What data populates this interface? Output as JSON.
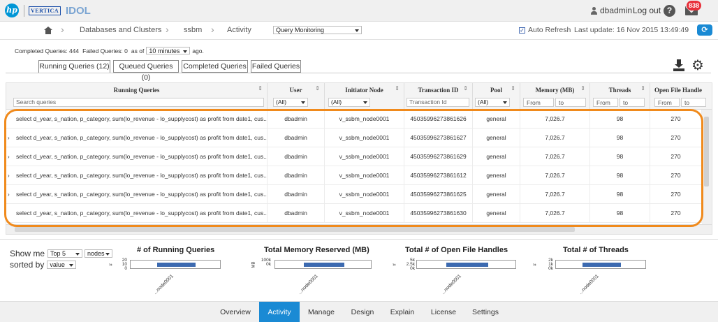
{
  "header": {
    "product_name": "IDOL",
    "vertica_logo": "VERTICA",
    "hp_logo": "hp",
    "username": "dbadmin",
    "logout_label": "Log out",
    "help_glyph": "?",
    "notification_count": "838"
  },
  "breadcrumb": {
    "items": [
      "Databases and Clusters",
      "ssbm",
      "Activity"
    ],
    "view_select": "Query Monitoring",
    "auto_refresh_label": "Auto Refresh",
    "auto_refresh_checked": true,
    "last_update": "Last update:  16 Nov 2015 13:49:49"
  },
  "stats": {
    "completed": "Completed Queries: 444",
    "failed": "Failed Queries: 0",
    "as_of": "as of",
    "interval": "10 minutes",
    "ago": "ago."
  },
  "tabs": [
    {
      "label": "Running Queries (12)",
      "active": true
    },
    {
      "label": "Queued Queries (0)",
      "active": false
    },
    {
      "label": "Completed Queries",
      "active": false
    },
    {
      "label": "Failed Queries",
      "active": false
    }
  ],
  "table": {
    "columns": [
      "Running Queries",
      "User",
      "Initiator Node",
      "Transaction ID",
      "Pool",
      "Memory (MB)",
      "Threads",
      "Open File Handle"
    ],
    "filters": {
      "search_placeholder": "Search queries",
      "user": "(All)",
      "node": "(All)",
      "txn_placeholder": "Transaction Id",
      "pool": "(All)",
      "from": "From",
      "to": "to"
    },
    "rows": [
      {
        "query": "select d_year, s_nation, p_category, sum(lo_revenue - lo_supplycost) as profit from date1, cus...",
        "user": "dbadmin",
        "node": "v_ssbm_node0001",
        "txn": "45035996273861626",
        "pool": "general",
        "memory": "7,026.7",
        "threads": "98",
        "handles": "270",
        "expander": ""
      },
      {
        "query": "select d_year, s_nation, p_category, sum(lo_revenue - lo_supplycost) as profit from date1, cus...",
        "user": "dbadmin",
        "node": "v_ssbm_node0001",
        "txn": "45035996273861627",
        "pool": "general",
        "memory": "7,026.7",
        "threads": "98",
        "handles": "270",
        "expander": "›"
      },
      {
        "query": "select d_year, s_nation, p_category, sum(lo_revenue - lo_supplycost) as profit from date1, cus...",
        "user": "dbadmin",
        "node": "v_ssbm_node0001",
        "txn": "45035996273861629",
        "pool": "general",
        "memory": "7,026.7",
        "threads": "98",
        "handles": "270",
        "expander": "›"
      },
      {
        "query": "select d_year, s_nation, p_category, sum(lo_revenue - lo_supplycost) as profit from date1, cus...",
        "user": "dbadmin",
        "node": "v_ssbm_node0001",
        "txn": "45035996273861612",
        "pool": "general",
        "memory": "7,026.7",
        "threads": "98",
        "handles": "270",
        "expander": "›"
      },
      {
        "query": "select d_year, s_nation, p_category, sum(lo_revenue - lo_supplycost) as profit from date1, cus...",
        "user": "dbadmin",
        "node": "v_ssbm_node0001",
        "txn": "45035996273861625",
        "pool": "general",
        "memory": "7,026.7",
        "threads": "98",
        "handles": "270",
        "expander": "›"
      },
      {
        "query": "select d_year, s_nation, p_category, sum(lo_revenue - lo_supplycost) as profit from date1, cus...",
        "user": "dbadmin",
        "node": "v_ssbm_node0001",
        "txn": "45035996273861630",
        "pool": "general",
        "memory": "7,026.7",
        "threads": "98",
        "handles": "270",
        "expander": ""
      }
    ]
  },
  "summary": {
    "show_me_label": "Show me",
    "top_select": "Top 5",
    "group_select": "nodes",
    "sorted_by_label": "sorted by",
    "sort_select": "value",
    "charts": [
      {
        "title": "# of Running Queries",
        "unit": "#",
        "ticks": [
          "20",
          "10",
          "0"
        ],
        "node_label": "...node0001",
        "bar_fill": 0.65
      },
      {
        "title": "Total Memory Reserved (MB)",
        "unit": "MB",
        "ticks": [
          "100k",
          "0k"
        ],
        "node_label": "...node0001",
        "bar_fill": 0.65
      },
      {
        "title": "Total # of Open File Handles",
        "unit": "#",
        "ticks": [
          "5k",
          "2.5k",
          "0k"
        ],
        "node_label": "...node0001",
        "bar_fill": 0.65
      },
      {
        "title": "Total # of Threads",
        "unit": "#",
        "ticks": [
          "2k",
          "1k",
          "0k"
        ],
        "node_label": "...node0001",
        "bar_fill": 0.65
      }
    ]
  },
  "bottom_nav": [
    {
      "label": "Overview",
      "active": false
    },
    {
      "label": "Activity",
      "active": true
    },
    {
      "label": "Manage",
      "active": false
    },
    {
      "label": "Design",
      "active": false
    },
    {
      "label": "Explain",
      "active": false
    },
    {
      "label": "License",
      "active": false
    },
    {
      "label": "Settings",
      "active": false
    }
  ],
  "colors": {
    "accent_blue": "#1a8ad4",
    "highlight_orange": "#f08a1c",
    "badge_red": "#e8303a",
    "bar_blue": "#3c6ab0"
  }
}
